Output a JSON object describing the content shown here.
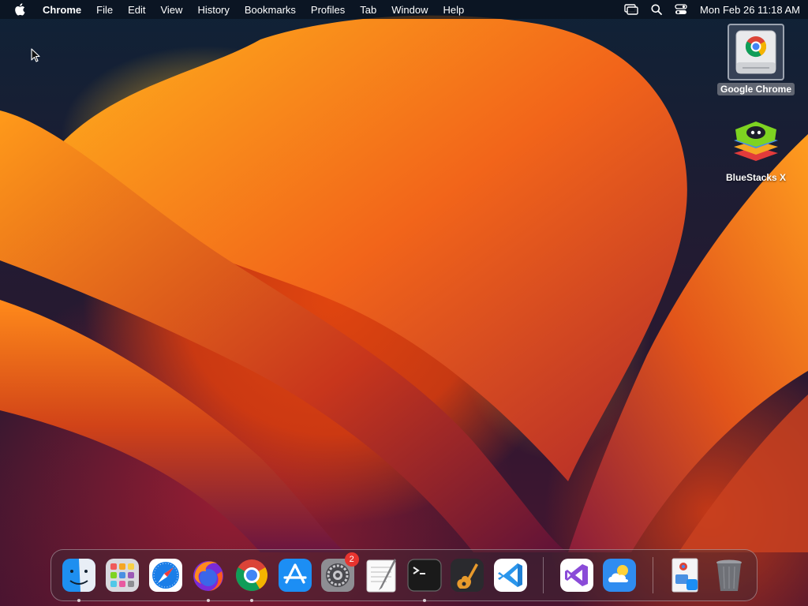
{
  "menubar": {
    "app_name": "Chrome",
    "items": [
      "File",
      "Edit",
      "View",
      "History",
      "Bookmarks",
      "Profiles",
      "Tab",
      "Window",
      "Help"
    ],
    "clock": "Mon Feb 26  11:18 AM"
  },
  "desktop": {
    "icons": [
      {
        "label": "Google Chrome",
        "icon": "chrome-disk-icon",
        "selected": true
      },
      {
        "label": "BlueStacks X",
        "icon": "bluestacks-icon",
        "selected": false
      }
    ]
  },
  "dock": {
    "apps": [
      {
        "name": "Finder",
        "icon": "finder-icon",
        "running": true
      },
      {
        "name": "Launchpad",
        "icon": "launchpad-icon",
        "running": false
      },
      {
        "name": "Safari",
        "icon": "safari-icon",
        "running": false
      },
      {
        "name": "Firefox",
        "icon": "firefox-icon",
        "running": true
      },
      {
        "name": "Google Chrome",
        "icon": "chrome-icon",
        "running": true
      },
      {
        "name": "App Store",
        "icon": "app-store-icon",
        "running": false
      },
      {
        "name": "System Settings",
        "icon": "system-settings-icon",
        "running": false,
        "badge": "2"
      },
      {
        "name": "TextEdit",
        "icon": "textedit-icon",
        "running": false
      },
      {
        "name": "Terminal",
        "icon": "terminal-icon",
        "running": true
      },
      {
        "name": "GarageBand",
        "icon": "garageband-icon",
        "running": false
      },
      {
        "name": "Visual Studio Code",
        "icon": "vscode-icon",
        "running": false
      },
      {
        "name": "Visual Studio",
        "icon": "visual-studio-icon",
        "running": false
      },
      {
        "name": "Weather",
        "icon": "weather-icon",
        "running": false
      },
      {
        "name": "Downloads Stack",
        "icon": "downloads-stack-icon",
        "running": false
      },
      {
        "name": "Trash",
        "icon": "trash-icon",
        "running": false
      }
    ]
  },
  "colors": {
    "badge": "#e8342f",
    "menubar_bg": "#0a121e"
  }
}
